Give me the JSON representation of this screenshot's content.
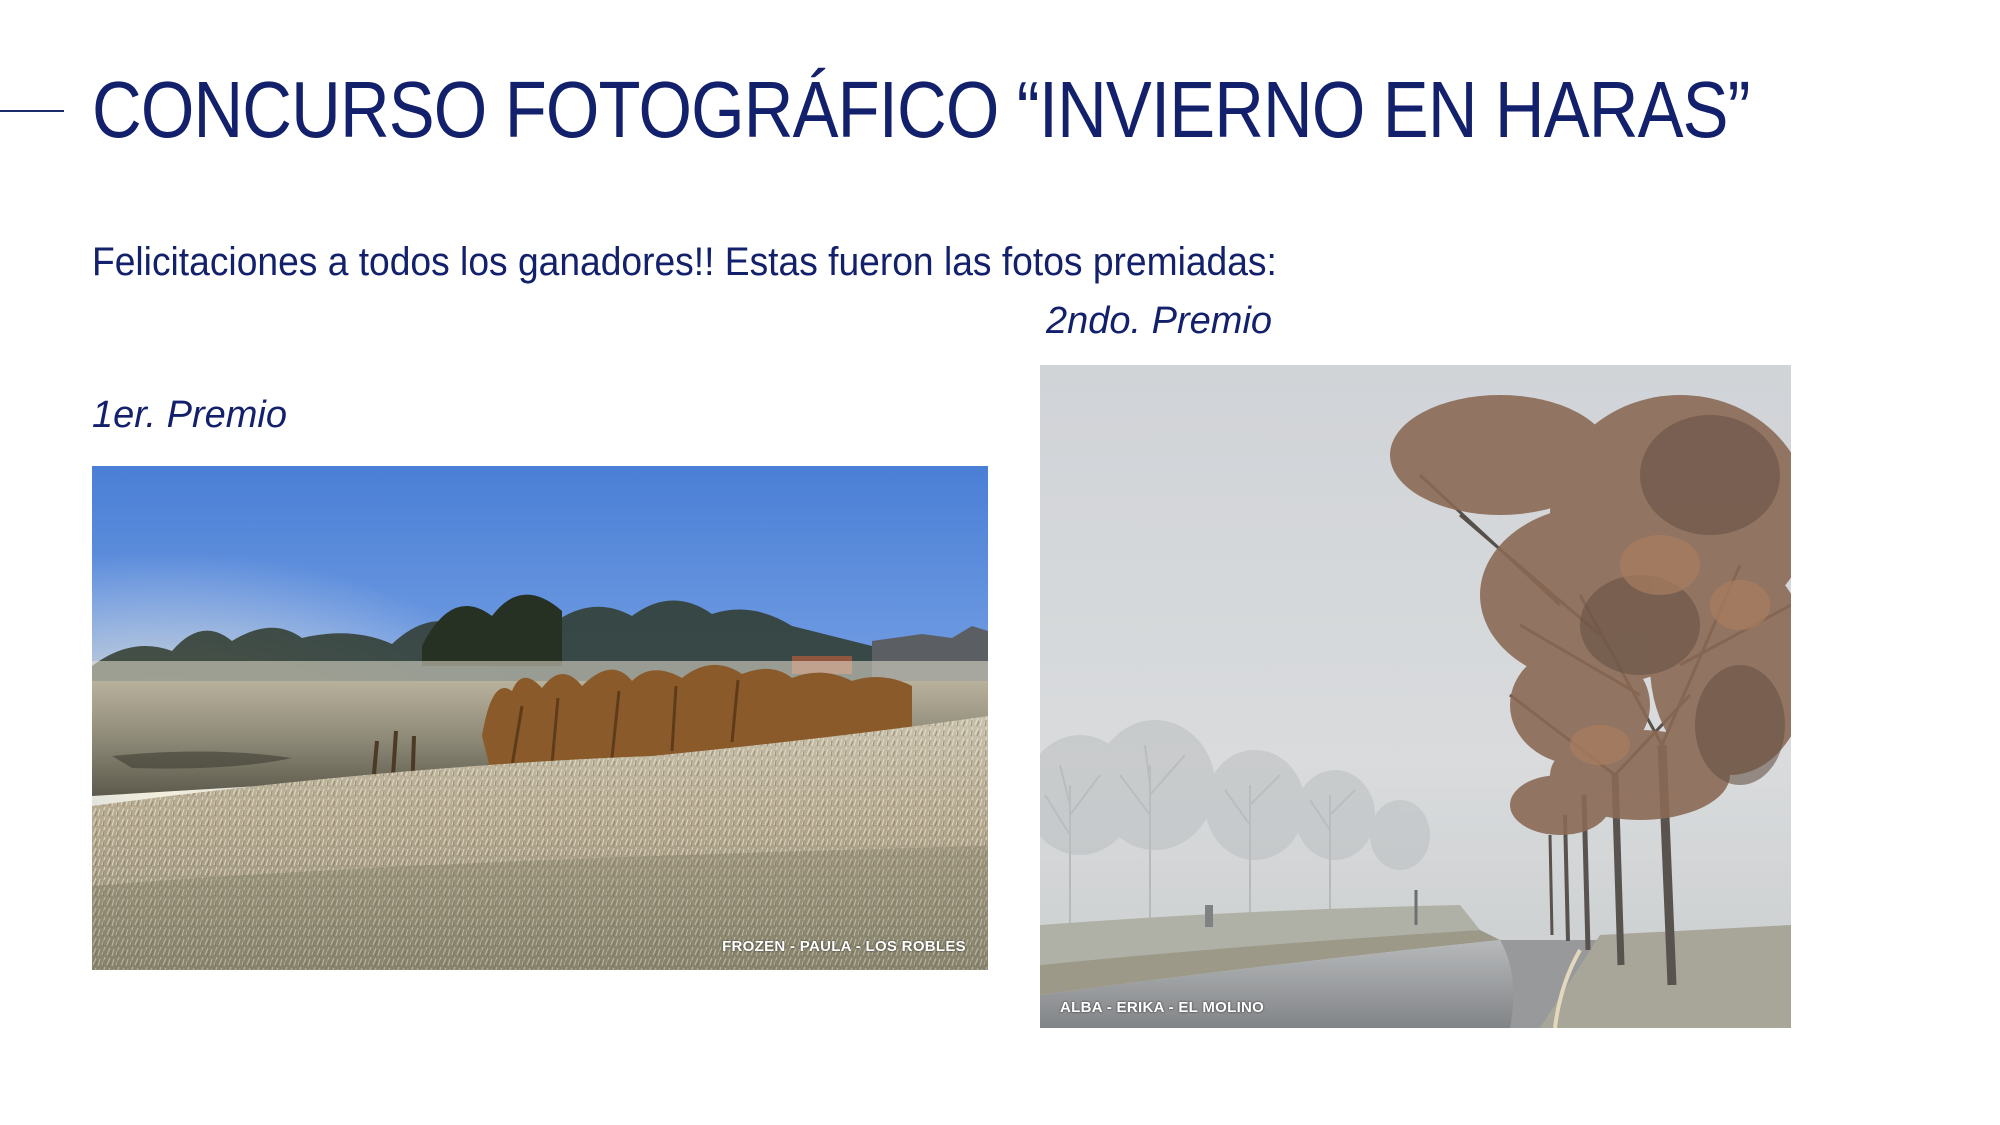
{
  "slide": {
    "title": "CONCURSO FOTOGRÁFICO “INVIERNO EN HARAS”",
    "subtitle": "Felicitaciones a todos los ganadores!! Estas fueron las fotos premiadas:"
  },
  "prizes": [
    {
      "label": "1er. Premio",
      "photo_caption": "FROZEN - PAULA - LOS ROBLES"
    },
    {
      "label": "2ndo. Premio",
      "photo_caption": "ALBA - ERIKA - EL MOLINO"
    }
  ],
  "colors": {
    "text_primary": "#13206b",
    "background": "#ffffff"
  }
}
